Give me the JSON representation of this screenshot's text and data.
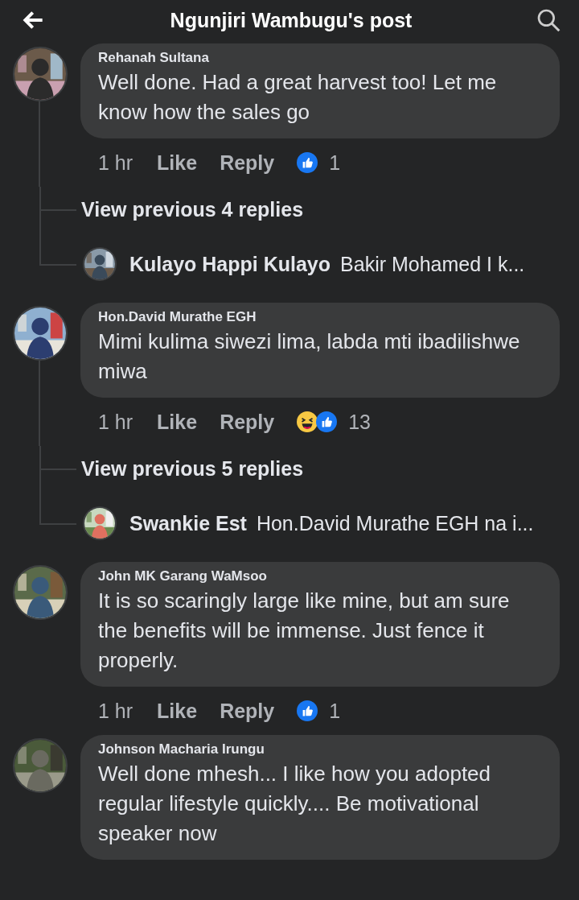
{
  "header": {
    "title": "Ngunjiri Wambugu's post"
  },
  "comments": [
    {
      "author": "Rehanah Sultana",
      "text": "Well done. Had a great harvest too! Let me know how the sales go",
      "time": "1 hr",
      "like": "Like",
      "reply": "Reply",
      "reactions": [
        {
          "kind": "like"
        }
      ],
      "reaction_count": "1",
      "replies_link": "View previous 4 replies",
      "reply_preview": {
        "author": "Kulayo Happi Kulayo",
        "text": "Bakir Mohamed I k..."
      }
    },
    {
      "author": "Hon.David Murathe EGH",
      "text": "Mimi kulima siwezi lima, labda mti ibadilishwe miwa",
      "time": "1 hr",
      "like": "Like",
      "reply": "Reply",
      "reactions": [
        {
          "kind": "haha"
        },
        {
          "kind": "like"
        }
      ],
      "reaction_count": "13",
      "replies_link": "View previous 5 replies",
      "reply_preview": {
        "author": "Swankie Est",
        "text": "Hon.David Murathe EGH na i..."
      }
    },
    {
      "author": "John MK Garang WaMsoo",
      "text": "It is so scaringly large like mine, but am sure the benefits will be immense. Just fence it properly.",
      "time": "1 hr",
      "like": "Like",
      "reply": "Reply",
      "reactions": [
        {
          "kind": "like"
        }
      ],
      "reaction_count": "1"
    },
    {
      "author": "Johnson Macharia Irungu",
      "text": "Well done mhesh... I like how you adopted regular lifestyle quickly.... Be motivational speaker now"
    }
  ]
}
